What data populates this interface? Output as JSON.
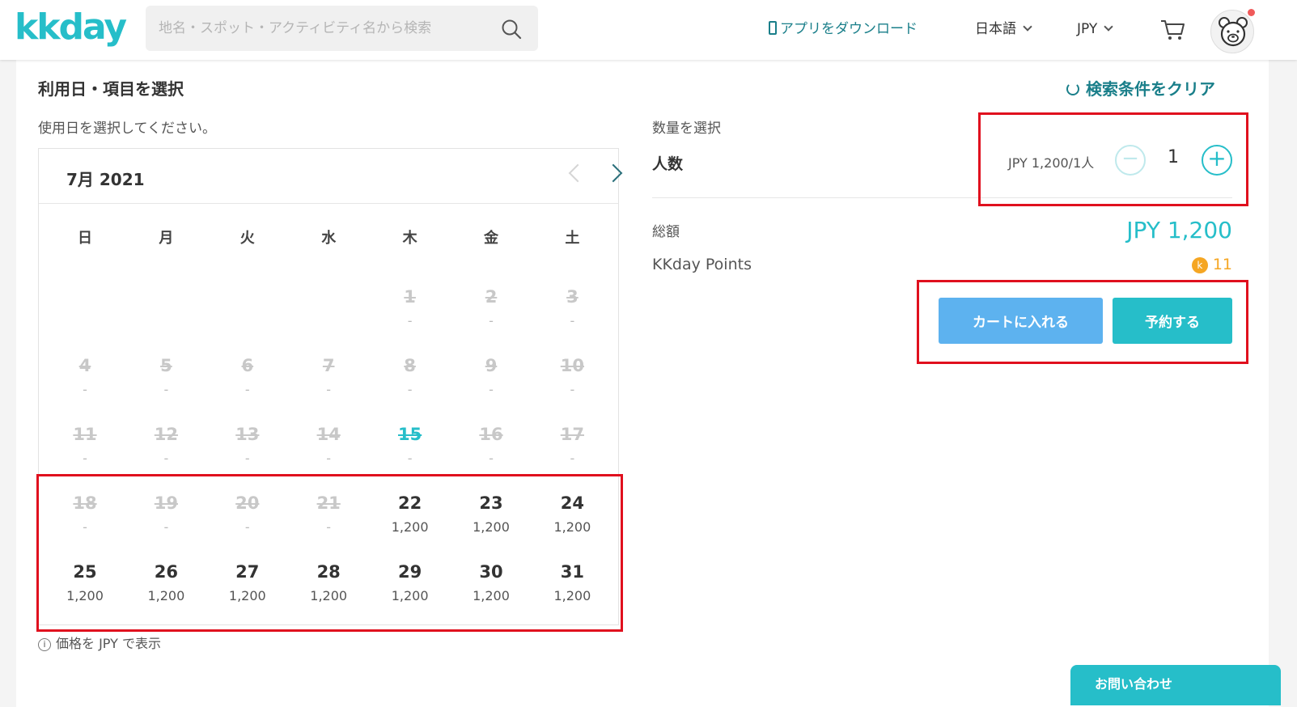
{
  "header": {
    "logo": "kkday",
    "search_placeholder": "地名・スポット・アクティビティ名から検索",
    "app_download": "アプリをダウンロード",
    "language": "日本語",
    "currency": "JPY"
  },
  "booking": {
    "title": "利用日・項目を選択",
    "clear": "検索条件をクリア",
    "date_prompt": "使用日を選択してください。",
    "price_note": "価格を JPY で表示"
  },
  "calendar": {
    "month": "7月 2021",
    "weekdays": [
      "日",
      "月",
      "火",
      "水",
      "木",
      "金",
      "土"
    ],
    "days": [
      {
        "d": "1",
        "p": "-",
        "state": "disabled"
      },
      {
        "d": "2",
        "p": "-",
        "state": "disabled"
      },
      {
        "d": "3",
        "p": "-",
        "state": "disabled"
      },
      {
        "d": "4",
        "p": "-",
        "state": "disabled"
      },
      {
        "d": "5",
        "p": "-",
        "state": "disabled"
      },
      {
        "d": "6",
        "p": "-",
        "state": "disabled"
      },
      {
        "d": "7",
        "p": "-",
        "state": "disabled"
      },
      {
        "d": "8",
        "p": "-",
        "state": "disabled"
      },
      {
        "d": "9",
        "p": "-",
        "state": "disabled"
      },
      {
        "d": "10",
        "p": "-",
        "state": "disabled"
      },
      {
        "d": "11",
        "p": "-",
        "state": "disabled"
      },
      {
        "d": "12",
        "p": "-",
        "state": "disabled"
      },
      {
        "d": "13",
        "p": "-",
        "state": "disabled"
      },
      {
        "d": "14",
        "p": "-",
        "state": "disabled"
      },
      {
        "d": "15",
        "p": "-",
        "state": "today"
      },
      {
        "d": "16",
        "p": "-",
        "state": "disabled"
      },
      {
        "d": "17",
        "p": "-",
        "state": "disabled"
      },
      {
        "d": "18",
        "p": "-",
        "state": "disabled"
      },
      {
        "d": "19",
        "p": "-",
        "state": "disabled"
      },
      {
        "d": "20",
        "p": "-",
        "state": "disabled"
      },
      {
        "d": "21",
        "p": "-",
        "state": "disabled"
      },
      {
        "d": "22",
        "p": "1,200",
        "state": "available"
      },
      {
        "d": "23",
        "p": "1,200",
        "state": "available"
      },
      {
        "d": "24",
        "p": "1,200",
        "state": "available"
      },
      {
        "d": "25",
        "p": "1,200",
        "state": "available"
      },
      {
        "d": "26",
        "p": "1,200",
        "state": "available"
      },
      {
        "d": "27",
        "p": "1,200",
        "state": "available"
      },
      {
        "d": "28",
        "p": "1,200",
        "state": "available"
      },
      {
        "d": "29",
        "p": "1,200",
        "state": "available"
      },
      {
        "d": "30",
        "p": "1,200",
        "state": "available"
      },
      {
        "d": "31",
        "p": "1,200",
        "state": "available"
      }
    ]
  },
  "quantity": {
    "label": "数量を選択",
    "people_label": "人数",
    "unit_price": "JPY 1,200/1人",
    "value": "1",
    "minus": "−",
    "plus": "+"
  },
  "summary": {
    "total_label": "総額",
    "total_value": "JPY 1,200",
    "points_label": "KKday Points",
    "points_value": "11",
    "points_coin": "k"
  },
  "actions": {
    "add_to_cart": "カートに入れる",
    "book": "予約する"
  },
  "chat": {
    "label": "お問い合わせ"
  },
  "colors": {
    "brand": "#26bec9",
    "highlight_box": "#e0101e",
    "cart_button": "#5db2ef"
  }
}
